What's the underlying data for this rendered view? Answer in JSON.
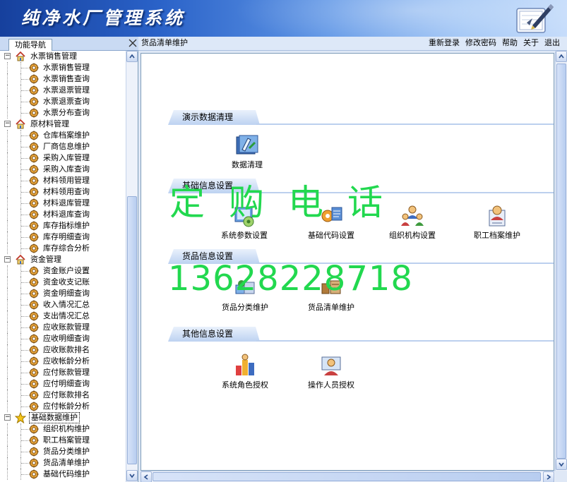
{
  "app": {
    "title": "纯净水厂管理系统"
  },
  "nav": {
    "tab_label": "功能导航"
  },
  "current_tab": {
    "label": "货品清单维护"
  },
  "toplinks": [
    {
      "id": "relogin",
      "label": "重新登录"
    },
    {
      "id": "password",
      "label": "修改密码"
    },
    {
      "id": "help",
      "label": "帮助"
    },
    {
      "id": "about",
      "label": "关于"
    },
    {
      "id": "exit",
      "label": "退出"
    }
  ],
  "tree": [
    {
      "label": "水票销售管理",
      "icon": "house-icon",
      "items": [
        "水票销售管理",
        "水票销售查询",
        "水票退票管理",
        "水票退票查询",
        "水票分布查询"
      ]
    },
    {
      "label": "原材料管理",
      "icon": "house-icon",
      "items": [
        "仓库档案维护",
        "厂商信息维护",
        "采购入库管理",
        "采购入库查询",
        "材料领用管理",
        "材料领用查询",
        "材料退库管理",
        "材料退库查询",
        "库存指标维护",
        "库存明细查询",
        "库存综合分析"
      ]
    },
    {
      "label": "资金管理",
      "icon": "house-icon",
      "items": [
        "资金账户设置",
        "资金收支记账",
        "资金明细查询",
        "收入情况汇总",
        "支出情况汇总",
        "应收账款管理",
        "应收明细查询",
        "应收账款排名",
        "应收帐龄分析",
        "应付账款管理",
        "应付明细查询",
        "应付账款排名",
        "应付帐龄分析"
      ]
    },
    {
      "label": "基础数据维护",
      "icon": "star-icon",
      "selected": true,
      "items": [
        "组织机构维护",
        "职工档案管理",
        "货品分类维护",
        "货品清单维护",
        "基础代码维护"
      ]
    }
  ],
  "sections": [
    {
      "title": "演示数据清理",
      "tools": [
        {
          "label": "数据清理",
          "icon": "data-clean-icon"
        }
      ]
    },
    {
      "title": "基础信息设置",
      "tools": [
        {
          "label": "系统参数设置",
          "icon": "system-params-icon"
        },
        {
          "label": "基础代码设置",
          "icon": "base-code-icon"
        },
        {
          "label": "组织机构设置",
          "icon": "org-structure-icon"
        },
        {
          "label": "职工档案维护",
          "icon": "staff-records-icon"
        }
      ]
    },
    {
      "title": "货品信息设置",
      "tools": [
        {
          "label": "货品分类维护",
          "icon": "goods-category-icon"
        },
        {
          "label": "货品清单维护",
          "icon": "goods-list-icon"
        }
      ]
    },
    {
      "title": "其他信息设置",
      "tools": [
        {
          "label": "系统角色授权",
          "icon": "role-auth-icon"
        },
        {
          "label": "操作人员授权",
          "icon": "operator-auth-icon"
        }
      ]
    }
  ],
  "watermark": {
    "line1": "定购电话",
    "line2": "13628228718"
  },
  "colors": {
    "watermark": "#22d84f",
    "header_dark": "#16409d",
    "section_tab": "#bdd2f1"
  }
}
